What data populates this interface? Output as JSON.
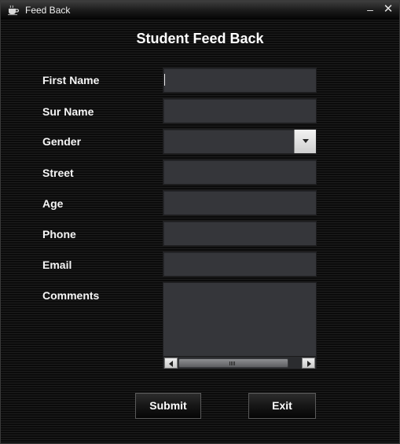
{
  "window": {
    "title": "Feed Back",
    "icon": "coffee-cup-icon",
    "minimize_glyph": "‒",
    "close_glyph": "✕"
  },
  "form": {
    "heading": "Student Feed Back",
    "labels": {
      "first_name": "First Name",
      "sur_name": "Sur Name",
      "gender": "Gender",
      "street": "Street",
      "age": "Age",
      "phone": "Phone",
      "email": "Email",
      "comments": "Comments"
    },
    "values": {
      "first_name": "",
      "sur_name": "",
      "gender": "",
      "street": "",
      "age": "",
      "phone": "",
      "email": "",
      "comments": ""
    }
  },
  "buttons": {
    "submit": "Submit",
    "exit": "Exit"
  }
}
